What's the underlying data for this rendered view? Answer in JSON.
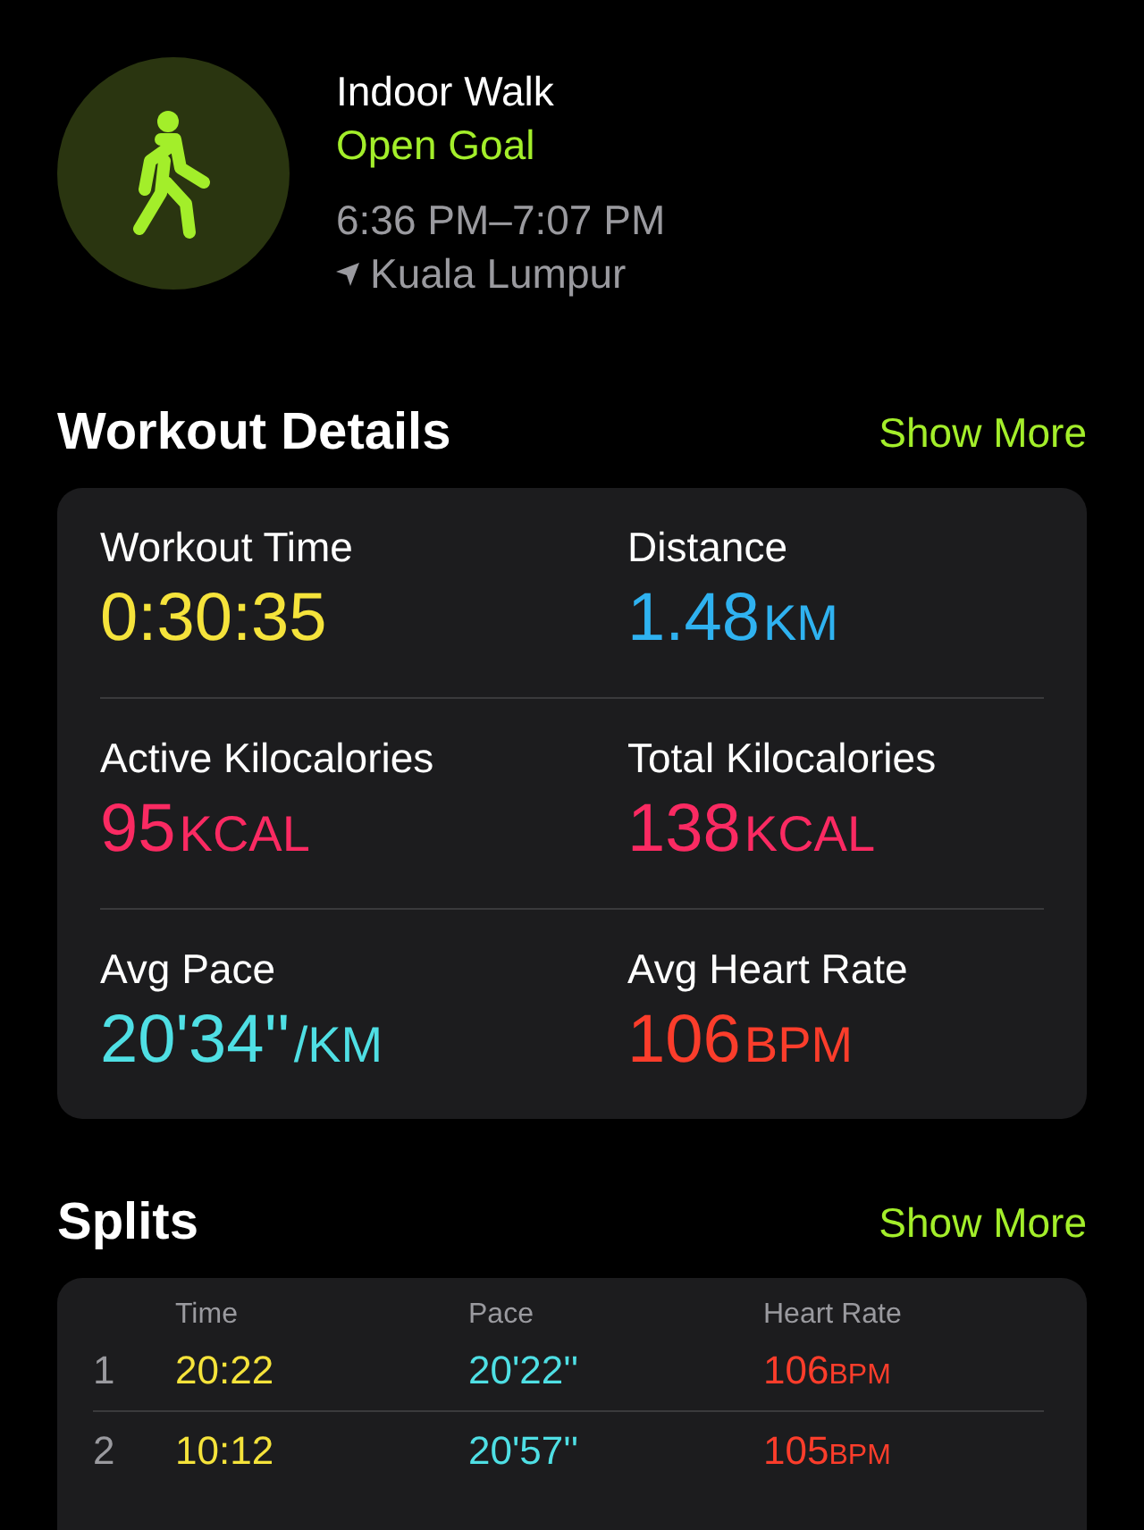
{
  "header": {
    "title": "Indoor Walk",
    "goal": "Open Goal",
    "time_range": "6:36 PM–7:07 PM",
    "location": "Kuala Lumpur"
  },
  "workout_details": {
    "title": "Workout Details",
    "action": "Show More",
    "metrics": [
      {
        "label": "Workout Time",
        "value": "0:30:35",
        "color": "#f5e33b"
      },
      {
        "label": "Distance",
        "value": "1.48",
        "unit": "KM",
        "color": "#2fb2f0"
      },
      {
        "label": "Active Kilocalories",
        "value": "95",
        "unit": "KCAL",
        "color": "#fa2a62"
      },
      {
        "label": "Total Kilocalories",
        "value": "138",
        "unit": "KCAL",
        "color": "#fa2a62"
      },
      {
        "label": "Avg Pace",
        "value": "20'34''",
        "unit": "/KM",
        "color": "#4fdfe4"
      },
      {
        "label": "Avg Heart Rate",
        "value": "106",
        "unit": "BPM",
        "color": "#fb3d2b"
      }
    ]
  },
  "splits": {
    "title": "Splits",
    "action": "Show More",
    "columns": [
      "Time",
      "Pace",
      "Heart Rate"
    ],
    "rows": [
      {
        "index": "1",
        "time": "20:22",
        "pace": "20'22''",
        "heart_rate": "106",
        "unit": "BPM"
      },
      {
        "index": "2",
        "time": "10:12",
        "pace": "20'57''",
        "heart_rate": "105",
        "unit": "BPM"
      }
    ]
  }
}
